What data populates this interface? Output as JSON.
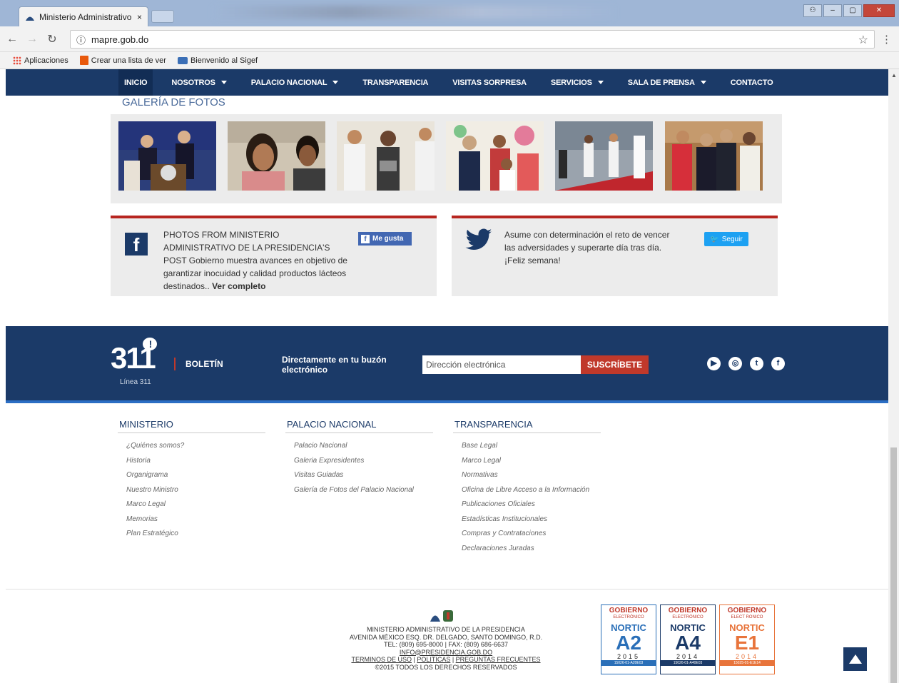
{
  "browser": {
    "tab_title": "Ministerio Administrativo",
    "tab_close": "×",
    "url": "mapre.gob.do",
    "info": "ⓘ",
    "bookmarks": [
      "Aplicaciones",
      "Crear una lista de ver",
      "Bienvenido al Sigef"
    ]
  },
  "nav": {
    "items": [
      {
        "label": "INICIO"
      },
      {
        "label": "NOSOTROS"
      },
      {
        "label": "PALACIO NACIONAL"
      },
      {
        "label": "TRANSPARENCIA"
      },
      {
        "label": "VISITAS SORPRESA"
      },
      {
        "label": "SERVICIOS"
      },
      {
        "label": "SALA DE PRENSA"
      },
      {
        "label": "CONTACTO"
      }
    ]
  },
  "gallery": {
    "title": "GALERÍA DE FOTOS"
  },
  "facebook": {
    "text_bold": "PHOTOS FROM MINISTERIO ADMINISTRATIVO DE LA PRESIDENCIA'S POST",
    "text": " Gobierno muestra avances en objetivo de garantizar inocuidad y calidad productos lácteos destinados..",
    "more": "Ver completo",
    "like": "Me gusta"
  },
  "twitter": {
    "text": "Asume con determinación el reto de vencer las adversidades y superarte día tras día. ¡Feliz semana!",
    "follow": "Seguir"
  },
  "boletin": {
    "logo_number": "311",
    "logo_caption": "Línea 311",
    "label": "BOLETÍN",
    "tagline": "Directamente en tu buzón electrónico",
    "email_placeholder": "Dirección electrónica",
    "subscribe": "SUSCRÍBETE"
  },
  "footer_columns": [
    {
      "title": "MINISTERIO",
      "links": [
        "¿Quiénes somos?",
        "Historia",
        "Organigrama",
        "Nuestro Ministro",
        "Marco Legal",
        "Memorias",
        "Plan Estratégico"
      ]
    },
    {
      "title": "PALACIO NACIONAL",
      "links": [
        "Palacio Nacional",
        "Galeria Expresidentes",
        "Visitas Guiadas",
        "Galería de Fotos del Palacio Nacional"
      ]
    },
    {
      "title": "TRANSPARENCIA",
      "links": [
        "Base Legal",
        "Marco Legal",
        "Normativas",
        "Oficina de Libre Acceso a la Información",
        "Publicaciones Oficiales",
        "Estadísticas Institucionales",
        "Compras y Contrataciones",
        "Declaraciones Juradas"
      ]
    }
  ],
  "bottom": {
    "org": "MINISTERIO ADMINISTRATIVO DE LA PRESIDENCIA",
    "address": "AVENIDA MÉXICO ESQ. DR. DELGADO, SANTO DOMINGO, R.D.",
    "phone": "TEL: (809) 695-8000 | FAX: (809) 686-6637",
    "email": "INFO@PRESIDENCIA.GOB.DO",
    "terms": "TERMINOS DE USO",
    "policies": "POLITICAS",
    "faq": "PREGUNTAS FRECUENTES",
    "copyright": "©2015 TODOS LOS DERECHOS RESERVADOS"
  },
  "nortic": [
    {
      "gob": "GOBIERNO",
      "sub": "ELECTRÓNICO",
      "nort": "NORTIC",
      "code": "A2",
      "year": "2015",
      "id": "15026-01-A20E03",
      "color": "#2a6fb8"
    },
    {
      "gob": "GOBIERNO",
      "sub": "ELECTRÓNICO",
      "nort": "NORTIC",
      "code": "A4",
      "year": "2014",
      "id": "15026-01-A40E03",
      "color": "#1b3a68"
    },
    {
      "gob": "GOBIERNO",
      "sub": "ELECT RONICO",
      "nort": "NORTIC",
      "code": "E1",
      "year": "2014",
      "id": "15025-01-E1E14",
      "color": "#e8743b"
    }
  ],
  "colors": {
    "navy": "#1b3a68",
    "red": "#c0392b",
    "link_blue": "#4a6a9a"
  }
}
